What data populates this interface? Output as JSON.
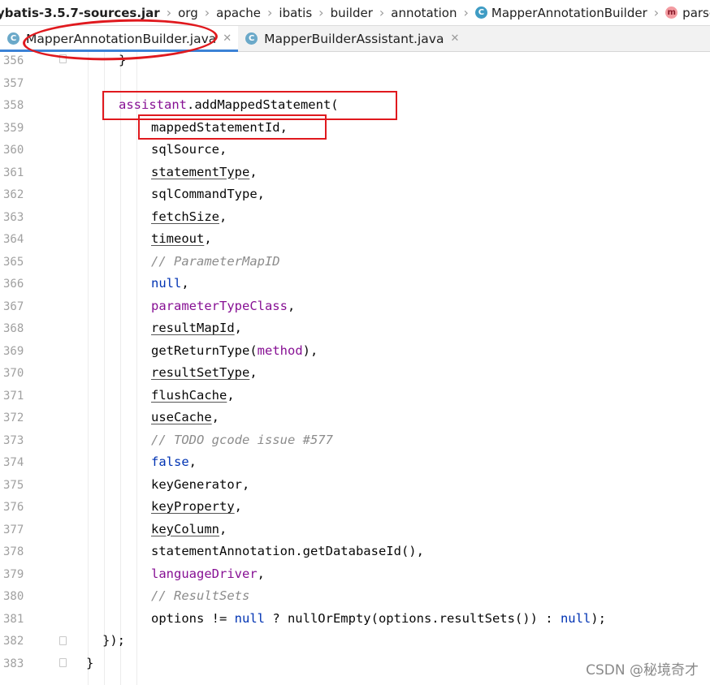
{
  "breadcrumb": [
    {
      "label": "ybatis-3.5.7-sources.jar",
      "icon": ""
    },
    {
      "label": "org",
      "icon": ""
    },
    {
      "label": "apache",
      "icon": ""
    },
    {
      "label": "ibatis",
      "icon": ""
    },
    {
      "label": "builder",
      "icon": ""
    },
    {
      "label": "annotation",
      "icon": ""
    },
    {
      "label": "MapperAnnotationBuilder",
      "icon": "C"
    },
    {
      "label": "parseState",
      "icon": "m"
    }
  ],
  "tabs": [
    {
      "label": "MapperAnnotationBuilder.java",
      "active": true,
      "icon": "C"
    },
    {
      "label": "MapperBuilderAssistant.java",
      "active": false,
      "icon": "C"
    }
  ],
  "editor": {
    "lines": [
      {
        "n": "356",
        "indent": 146,
        "tokens": [
          {
            "t": "}",
            "c": ""
          }
        ]
      },
      {
        "n": "357",
        "indent": 146,
        "tokens": []
      },
      {
        "n": "358",
        "indent": 146,
        "tokens": [
          {
            "t": "assistant",
            "c": "fld"
          },
          {
            "t": ".addMappedStatement(",
            "c": ""
          }
        ]
      },
      {
        "n": "359",
        "indent": 186,
        "tokens": [
          {
            "t": "mappedStatementId",
            "c": ""
          },
          {
            "t": ",",
            "c": ""
          }
        ]
      },
      {
        "n": "360",
        "indent": 186,
        "tokens": [
          {
            "t": "sqlSource",
            "c": ""
          },
          {
            "t": ",",
            "c": ""
          }
        ]
      },
      {
        "n": "361",
        "indent": 186,
        "tokens": [
          {
            "t": "statementType",
            "c": "ul"
          },
          {
            "t": ",",
            "c": ""
          }
        ]
      },
      {
        "n": "362",
        "indent": 186,
        "tokens": [
          {
            "t": "sqlCommandType",
            "c": ""
          },
          {
            "t": ",",
            "c": ""
          }
        ]
      },
      {
        "n": "363",
        "indent": 186,
        "tokens": [
          {
            "t": "fetchSize",
            "c": "ul"
          },
          {
            "t": ",",
            "c": ""
          }
        ]
      },
      {
        "n": "364",
        "indent": 186,
        "tokens": [
          {
            "t": "timeout",
            "c": "ul"
          },
          {
            "t": ",",
            "c": ""
          }
        ]
      },
      {
        "n": "365",
        "indent": 186,
        "tokens": [
          {
            "t": "// ParameterMapID",
            "c": "cmt"
          }
        ]
      },
      {
        "n": "366",
        "indent": 186,
        "tokens": [
          {
            "t": "null",
            "c": "kw"
          },
          {
            "t": ",",
            "c": ""
          }
        ]
      },
      {
        "n": "367",
        "indent": 186,
        "tokens": [
          {
            "t": "parameterTypeClass",
            "c": "fld"
          },
          {
            "t": ",",
            "c": ""
          }
        ]
      },
      {
        "n": "368",
        "indent": 186,
        "tokens": [
          {
            "t": "resultMapId",
            "c": "ul"
          },
          {
            "t": ",",
            "c": ""
          }
        ]
      },
      {
        "n": "369",
        "indent": 186,
        "tokens": [
          {
            "t": "getReturnType(",
            "c": ""
          },
          {
            "t": "method",
            "c": "fld"
          },
          {
            "t": "),",
            "c": ""
          }
        ]
      },
      {
        "n": "370",
        "indent": 186,
        "tokens": [
          {
            "t": "resultSetType",
            "c": "ul"
          },
          {
            "t": ",",
            "c": ""
          }
        ]
      },
      {
        "n": "371",
        "indent": 186,
        "tokens": [
          {
            "t": "flushCache",
            "c": "ul"
          },
          {
            "t": ",",
            "c": ""
          }
        ]
      },
      {
        "n": "372",
        "indent": 186,
        "tokens": [
          {
            "t": "useCache",
            "c": "ul"
          },
          {
            "t": ",",
            "c": ""
          }
        ]
      },
      {
        "n": "373",
        "indent": 186,
        "tokens": [
          {
            "t": "// TODO gcode issue #577",
            "c": "cmt"
          }
        ]
      },
      {
        "n": "374",
        "indent": 186,
        "tokens": [
          {
            "t": "false",
            "c": "kw"
          },
          {
            "t": ",",
            "c": ""
          }
        ]
      },
      {
        "n": "375",
        "indent": 186,
        "tokens": [
          {
            "t": "keyGenerator",
            "c": ""
          },
          {
            "t": ",",
            "c": ""
          }
        ]
      },
      {
        "n": "376",
        "indent": 186,
        "tokens": [
          {
            "t": "keyProperty",
            "c": "ul"
          },
          {
            "t": ",",
            "c": ""
          }
        ]
      },
      {
        "n": "377",
        "indent": 186,
        "tokens": [
          {
            "t": "keyColumn",
            "c": "ul"
          },
          {
            "t": ",",
            "c": ""
          }
        ]
      },
      {
        "n": "378",
        "indent": 186,
        "tokens": [
          {
            "t": "statementAnnotation.getDatabaseId(),",
            "c": ""
          }
        ]
      },
      {
        "n": "379",
        "indent": 186,
        "tokens": [
          {
            "t": "languageDriver",
            "c": "fld"
          },
          {
            "t": ",",
            "c": ""
          }
        ]
      },
      {
        "n": "380",
        "indent": 186,
        "tokens": [
          {
            "t": "// ResultSets",
            "c": "cmt"
          }
        ]
      },
      {
        "n": "381",
        "indent": 186,
        "tokens": [
          {
            "t": "options != ",
            "c": ""
          },
          {
            "t": "null",
            "c": "kw"
          },
          {
            "t": " ? nullOrEmpty(options.resultSets()) : ",
            "c": ""
          },
          {
            "t": "null",
            "c": "kw"
          },
          {
            "t": ");",
            "c": ""
          }
        ]
      },
      {
        "n": "382",
        "indent": 126,
        "tokens": [
          {
            "t": "});",
            "c": ""
          }
        ]
      },
      {
        "n": "383",
        "indent": 106,
        "tokens": [
          {
            "t": "}",
            "c": ""
          }
        ]
      }
    ]
  },
  "watermark": "CSDN @秘境奇才"
}
